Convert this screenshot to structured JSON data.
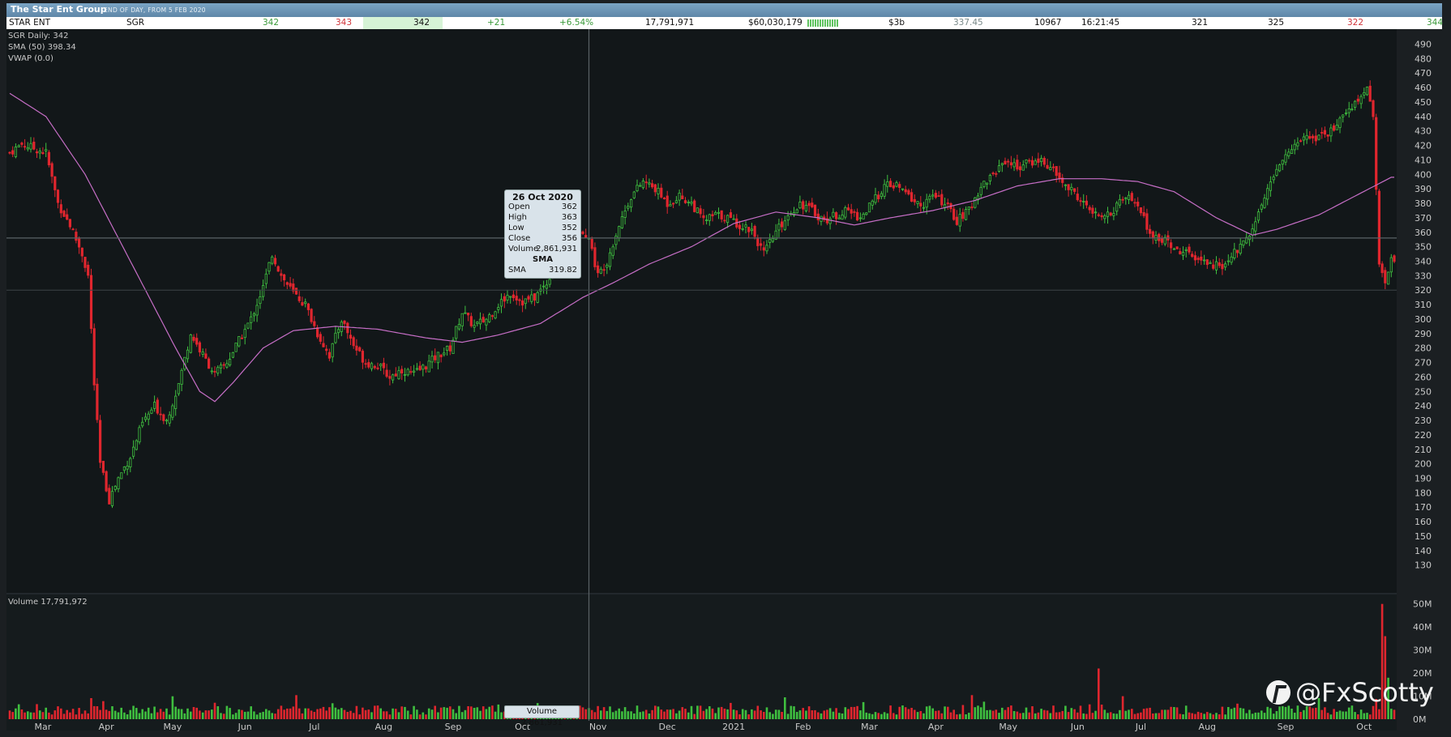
{
  "header": {
    "title": "The Star Ent Group",
    "subtitle": "END OF DAY, FROM 5 FEB 2020"
  },
  "quote": {
    "name": "STAR ENT",
    "code": "SGR",
    "last": "342",
    "bid": "343",
    "ask": "342",
    "change": "+21",
    "change_pct": "+6.54%",
    "volume": "17,791,971",
    "value": "$60,030,179",
    "mkt_cap": "$3b",
    "vwap": "337.45",
    "trades": "10967",
    "time": "16:21:45",
    "open": "321",
    "high": "325",
    "low": "322",
    "close": "344"
  },
  "indicators": {
    "daily": "SGR Daily: 342",
    "sma": "SMA (50) 398.34",
    "vwap": "VWAP (0.0)",
    "volume": "Volume 17,791,972"
  },
  "tooltip": {
    "date": "26 Oct 2020",
    "open_label": "Open",
    "open": "362",
    "high_label": "High",
    "high": "363",
    "low_label": "Low",
    "low": "352",
    "close_label": "Close",
    "close": "356",
    "volume_label": "Volume",
    "volume": "2,861,931",
    "sma_header": "SMA",
    "sma_label": "SMA",
    "sma": "319.82"
  },
  "volume_tag": "Volume 2,861,931",
  "watermark": "@FxScotty",
  "colors": {
    "up": "#3fbf3f",
    "down": "#e0262e",
    "sma": "#c66ec6",
    "bg": "#121719"
  },
  "chart_data": {
    "type": "candlestick",
    "x_tick_labels": [
      "Mar",
      "Apr",
      "May",
      "Jun",
      "Jul",
      "Aug",
      "Sep",
      "Oct",
      "Nov",
      "Dec",
      "2021",
      "Feb",
      "Mar",
      "Apr",
      "May",
      "Jun",
      "Jul",
      "Aug",
      "Sep",
      "Oct"
    ],
    "y_ticks": [
      130,
      140,
      150,
      160,
      170,
      180,
      190,
      200,
      210,
      220,
      230,
      240,
      250,
      260,
      270,
      280,
      290,
      300,
      310,
      320,
      330,
      340,
      350,
      360,
      370,
      380,
      390,
      400,
      410,
      420,
      430,
      440,
      450,
      460,
      470,
      480,
      490
    ],
    "ylim": [
      122,
      497
    ],
    "volume_ticks": [
      "0M",
      "10M",
      "20M",
      "30M",
      "40M",
      "50M"
    ],
    "volume_ylim": [
      0,
      52
    ],
    "crosshair_y": 356,
    "reference_line_y": 320,
    "close_anchors": [
      [
        0,
        415
      ],
      [
        4,
        421
      ],
      [
        8,
        418
      ],
      [
        12,
        415
      ],
      [
        16,
        380
      ],
      [
        20,
        365
      ],
      [
        24,
        345
      ],
      [
        26,
        330
      ],
      [
        28,
        255
      ],
      [
        30,
        200
      ],
      [
        33,
        175
      ],
      [
        36,
        190
      ],
      [
        40,
        205
      ],
      [
        44,
        228
      ],
      [
        48,
        240
      ],
      [
        52,
        230
      ],
      [
        56,
        255
      ],
      [
        60,
        290
      ],
      [
        64,
        275
      ],
      [
        68,
        262
      ],
      [
        72,
        270
      ],
      [
        76,
        285
      ],
      [
        80,
        300
      ],
      [
        84,
        322
      ],
      [
        87,
        345
      ],
      [
        90,
        330
      ],
      [
        94,
        318
      ],
      [
        98,
        310
      ],
      [
        102,
        290
      ],
      [
        106,
        275
      ],
      [
        110,
        300
      ],
      [
        114,
        282
      ],
      [
        118,
        270
      ],
      [
        122,
        268
      ],
      [
        126,
        260
      ],
      [
        130,
        265
      ],
      [
        134,
        262
      ],
      [
        138,
        268
      ],
      [
        142,
        275
      ],
      [
        146,
        280
      ],
      [
        150,
        305
      ],
      [
        154,
        295
      ],
      [
        158,
        300
      ],
      [
        162,
        310
      ],
      [
        166,
        318
      ],
      [
        170,
        312
      ],
      [
        174,
        315
      ],
      [
        178,
        325
      ],
      [
        182,
        345
      ],
      [
        186,
        360
      ],
      [
        190,
        362
      ],
      [
        192,
        356
      ],
      [
        195,
        330
      ],
      [
        198,
        340
      ],
      [
        202,
        365
      ],
      [
        206,
        385
      ],
      [
        210,
        395
      ],
      [
        214,
        390
      ],
      [
        218,
        380
      ],
      [
        222,
        385
      ],
      [
        226,
        380
      ],
      [
        230,
        368
      ],
      [
        234,
        372
      ],
      [
        238,
        370
      ],
      [
        242,
        365
      ],
      [
        246,
        362
      ],
      [
        250,
        345
      ],
      [
        254,
        360
      ],
      [
        258,
        372
      ],
      [
        262,
        380
      ],
      [
        266,
        375
      ],
      [
        270,
        368
      ],
      [
        274,
        372
      ],
      [
        278,
        375
      ],
      [
        282,
        370
      ],
      [
        286,
        380
      ],
      [
        290,
        392
      ],
      [
        294,
        392
      ],
      [
        298,
        385
      ],
      [
        302,
        378
      ],
      [
        306,
        385
      ],
      [
        310,
        380
      ],
      [
        314,
        368
      ],
      [
        318,
        375
      ],
      [
        322,
        392
      ],
      [
        326,
        400
      ],
      [
        330,
        410
      ],
      [
        334,
        405
      ],
      [
        338,
        408
      ],
      [
        342,
        410
      ],
      [
        346,
        402
      ],
      [
        350,
        392
      ],
      [
        354,
        385
      ],
      [
        358,
        375
      ],
      [
        362,
        368
      ],
      [
        366,
        375
      ],
      [
        370,
        385
      ],
      [
        374,
        378
      ],
      [
        378,
        360
      ],
      [
        382,
        355
      ],
      [
        386,
        350
      ],
      [
        390,
        345
      ],
      [
        394,
        340
      ],
      [
        398,
        338
      ],
      [
        402,
        336
      ],
      [
        406,
        346
      ],
      [
        410,
        355
      ],
      [
        414,
        375
      ],
      [
        418,
        395
      ],
      [
        422,
        410
      ],
      [
        426,
        420
      ],
      [
        430,
        428
      ],
      [
        434,
        425
      ],
      [
        438,
        430
      ],
      [
        442,
        440
      ],
      [
        446,
        450
      ],
      [
        450,
        458
      ],
      [
        452,
        440
      ],
      [
        454,
        340
      ],
      [
        456,
        325
      ],
      [
        458,
        342
      ]
    ],
    "sma_anchors": [
      [
        0,
        456
      ],
      [
        12,
        440
      ],
      [
        25,
        400
      ],
      [
        40,
        340
      ],
      [
        55,
        280
      ],
      [
        63,
        250
      ],
      [
        68,
        243
      ],
      [
        74,
        256
      ],
      [
        84,
        280
      ],
      [
        94,
        292
      ],
      [
        108,
        295
      ],
      [
        122,
        293
      ],
      [
        138,
        287
      ],
      [
        150,
        284
      ],
      [
        162,
        289
      ],
      [
        176,
        297
      ],
      [
        190,
        315
      ],
      [
        200,
        325
      ],
      [
        212,
        338
      ],
      [
        226,
        350
      ],
      [
        240,
        366
      ],
      [
        254,
        374
      ],
      [
        268,
        370
      ],
      [
        280,
        365
      ],
      [
        292,
        370
      ],
      [
        306,
        375
      ],
      [
        320,
        382
      ],
      [
        334,
        392
      ],
      [
        348,
        397
      ],
      [
        362,
        397
      ],
      [
        374,
        395
      ],
      [
        386,
        388
      ],
      [
        400,
        370
      ],
      [
        412,
        358
      ],
      [
        420,
        362
      ],
      [
        434,
        372
      ],
      [
        446,
        385
      ],
      [
        458,
        398
      ]
    ],
    "volume_spikes": [
      [
        361,
        22
      ],
      [
        455,
        50
      ],
      [
        456,
        36
      ],
      [
        457,
        18
      ]
    ],
    "tooltip_index": 192,
    "bars": 460
  }
}
